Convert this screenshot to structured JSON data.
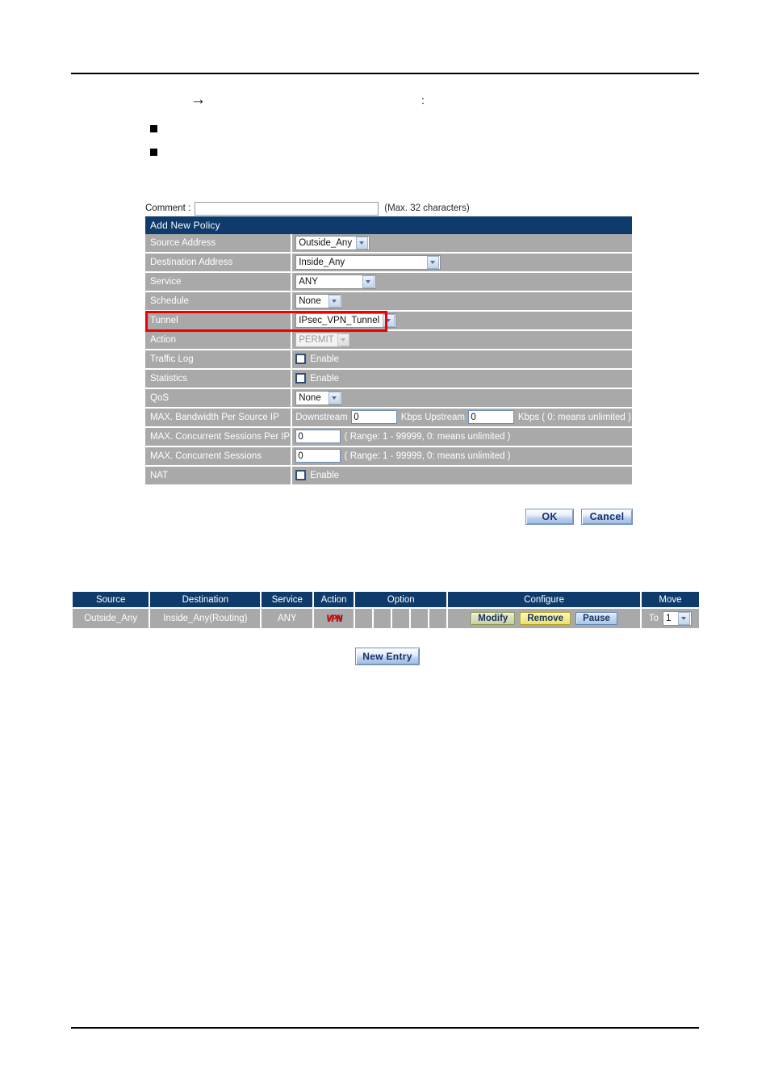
{
  "intro": {
    "arrow_glyph": "→",
    "colon_glyph": ":",
    "bullet_glyph": "■"
  },
  "comment": {
    "label": "Comment :",
    "value": "",
    "placeholder": "",
    "hint": "(Max. 32 characters)"
  },
  "form": {
    "title": "Add New Policy",
    "rows": [
      {
        "label": "Source Address",
        "value": "Outside_Any"
      },
      {
        "label": "Destination Address",
        "value": "Inside_Any"
      },
      {
        "label": "Service",
        "value": "ANY"
      },
      {
        "label": "Schedule",
        "value": "None"
      },
      {
        "label": "Tunnel",
        "value": "IPsec_VPN_Tunnel"
      },
      {
        "label": "Action",
        "value": "PERMIT"
      },
      {
        "label": "Traffic Log",
        "value": "Enable"
      },
      {
        "label": "Statistics",
        "value": "Enable"
      },
      {
        "label": "QoS",
        "value": "None"
      },
      {
        "label": "MAX. Bandwidth Per Source IP",
        "value": ""
      },
      {
        "label": "MAX. Concurrent Sessions Per IP",
        "value": "0"
      },
      {
        "label": "MAX. Concurrent Sessions",
        "value": "0"
      },
      {
        "label": "NAT",
        "value": "Enable"
      }
    ],
    "bandwidth": {
      "downstream_label": "Downstream",
      "downstream_value": "0",
      "kbps_upstream_label": "Kbps Upstream",
      "upstream_value": "0",
      "kbps_suffix": "Kbps ( 0: means unlimited )"
    },
    "sessions_per_ip_hint": "( Range: 1 - 99999, 0: means unlimited )",
    "sessions_hint": "( Range: 1 - 99999, 0: means unlimited )",
    "checkbox_label": "Enable",
    "buttons": {
      "ok": "OK",
      "cancel": "Cancel"
    },
    "highlight_color": "#ee0000"
  },
  "policy_list": {
    "headers": [
      "Source",
      "Destination",
      "Service",
      "Action",
      "Option",
      "Configure",
      "Move"
    ],
    "rows": [
      {
        "source": "Outside_Any",
        "destination": "Inside_Any(Routing)",
        "service": "ANY",
        "action_badge": "VPN",
        "options": [
          "",
          "",
          "",
          "",
          ""
        ],
        "configure": [
          "Modify",
          "Remove",
          "Pause"
        ],
        "move_label": "To",
        "move_value": "1"
      }
    ],
    "new_entry_label": "New  Entry"
  },
  "colors": {
    "header_navy": "#0e3b6b",
    "cell_gray": "#a9a9a9",
    "vpn_red": "#d01515",
    "highlight_red": "#ee0000"
  }
}
